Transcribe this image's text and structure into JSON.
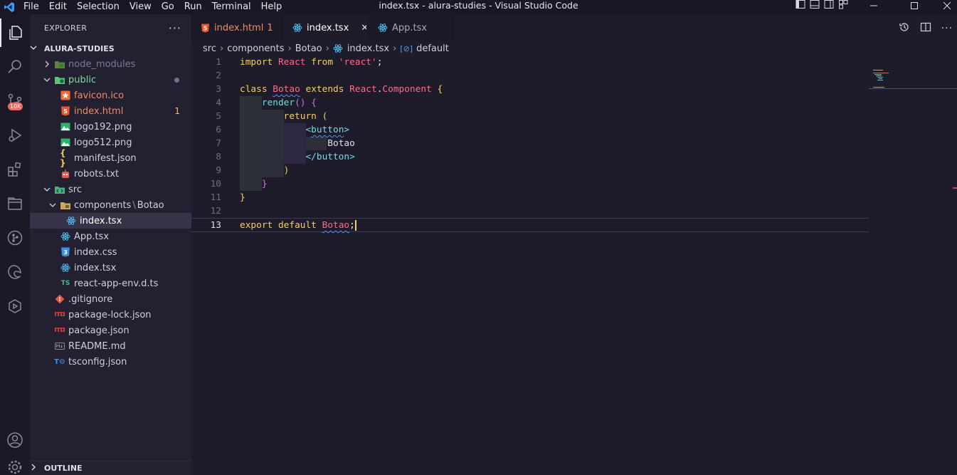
{
  "window": {
    "title": "index.tsx - alura-studies - Visual Studio Code",
    "menu": [
      "File",
      "Edit",
      "Selection",
      "View",
      "Go",
      "Run",
      "Terminal",
      "Help"
    ]
  },
  "activity_bar": {
    "items": [
      {
        "name": "explorer-icon",
        "active": true
      },
      {
        "name": "search-icon"
      },
      {
        "name": "source-control-icon",
        "badge": "10K"
      },
      {
        "name": "run-debug-icon"
      },
      {
        "name": "extensions-icon"
      },
      {
        "name": "remote-explorer-icon"
      },
      {
        "name": "git-graph-icon"
      },
      {
        "name": "edge-devtools-icon"
      },
      {
        "name": "live-share-icon"
      }
    ],
    "bottom": [
      "account-icon",
      "settings-gear-icon"
    ]
  },
  "sidebar": {
    "title": "EXPLORER",
    "root": "ALURA-STUDIES",
    "tree": [
      {
        "label": "node_modules",
        "kind": "folder",
        "collapsed": true,
        "dim": true
      },
      {
        "label": "public",
        "kind": "folder",
        "collapsed": false,
        "modified_dot": true
      },
      {
        "label": "favicon.ico",
        "kind": "file",
        "icon": "star-icon"
      },
      {
        "label": "index.html",
        "kind": "file",
        "icon": "html5-icon",
        "count": "1"
      },
      {
        "label": "logo192.png",
        "kind": "file",
        "icon": "image-icon"
      },
      {
        "label": "logo512.png",
        "kind": "file",
        "icon": "image-icon"
      },
      {
        "label": "manifest.json",
        "kind": "file",
        "icon": "json-braces-icon"
      },
      {
        "label": "robots.txt",
        "kind": "file",
        "icon": "robot-icon"
      },
      {
        "label": "src",
        "kind": "folder",
        "collapsed": false
      },
      {
        "label": "components",
        "label2": "Botao",
        "kind": "folder",
        "collapsed": false
      },
      {
        "label": "index.tsx",
        "kind": "file",
        "icon": "react-icon",
        "selected": true
      },
      {
        "label": "App.tsx",
        "kind": "file",
        "icon": "react-icon"
      },
      {
        "label": "index.css",
        "kind": "file",
        "icon": "css3-icon"
      },
      {
        "label": "index.tsx",
        "kind": "file",
        "icon": "react-icon"
      },
      {
        "label": "react-app-env.d.ts",
        "kind": "file",
        "icon": "typescript-icon"
      },
      {
        "label": ".gitignore",
        "kind": "file",
        "icon": "git-icon"
      },
      {
        "label": "package-lock.json",
        "kind": "file",
        "icon": "npm-icon"
      },
      {
        "label": "package.json",
        "kind": "file",
        "icon": "npm-icon"
      },
      {
        "label": "README.md",
        "kind": "file",
        "icon": "markdown-icon"
      },
      {
        "label": "tsconfig.json",
        "kind": "file",
        "icon": "tsconfig-icon"
      }
    ],
    "outline": "OUTLINE"
  },
  "tabs": [
    {
      "label": "index.html",
      "suffix": "1",
      "icon": "html5-icon"
    },
    {
      "label": "index.tsx",
      "icon": "react-icon",
      "active": true,
      "close": "✕"
    },
    {
      "label": "App.tsx",
      "icon": "react-icon"
    }
  ],
  "breadcrumb": [
    "src",
    "components",
    "Botao",
    "index.tsx",
    "default"
  ],
  "editor": {
    "current_line": 13,
    "line_numbers": [
      "1",
      "2",
      "3",
      "4",
      "5",
      "6",
      "7",
      "8",
      "9",
      "10",
      "11",
      "12",
      "13"
    ]
  }
}
